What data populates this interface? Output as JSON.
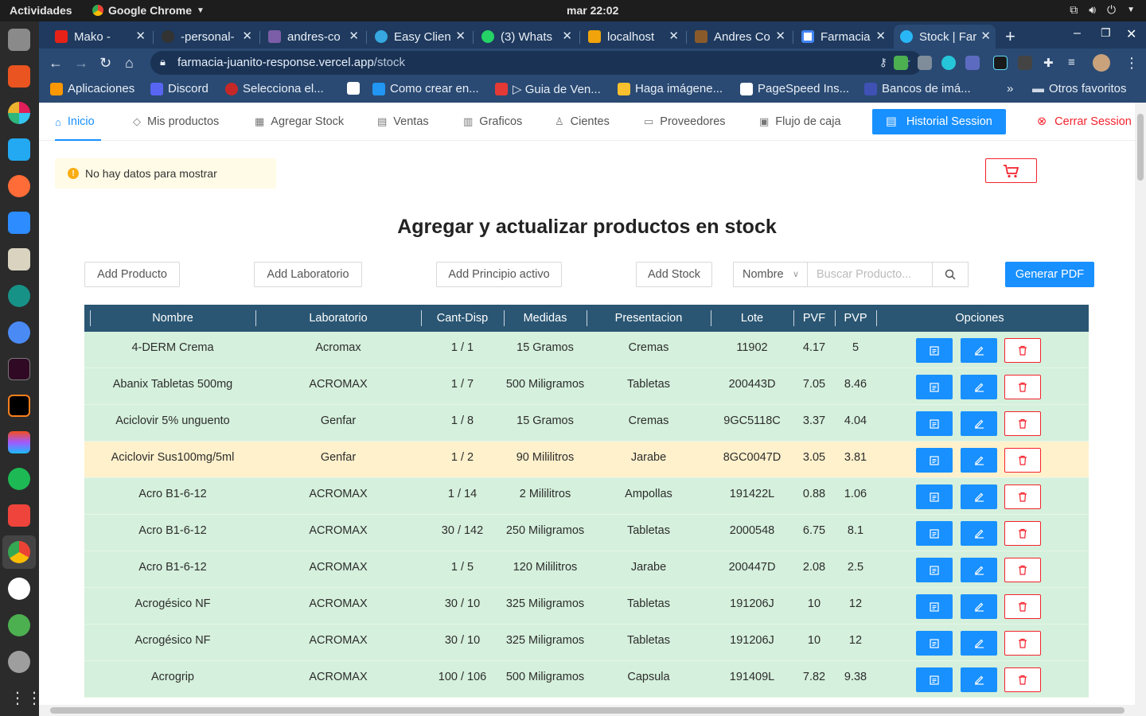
{
  "os": {
    "activities": "Actividades",
    "app_name": "Google Chrome",
    "clock": "mar 22:02"
  },
  "browser": {
    "tabs": [
      {
        "title": "Mako -",
        "color": "#e62117"
      },
      {
        "title": "-personal-",
        "color": "#333333"
      },
      {
        "title": "andres-co",
        "color": "#7b5ea7"
      },
      {
        "title": "Easy Clien",
        "color": "#36a7e0"
      },
      {
        "title": "(3) Whats",
        "color": "#25d366"
      },
      {
        "title": "localhost",
        "color": "#f0a30a"
      },
      {
        "title": "Andres Co",
        "color": "#8b5a2b"
      },
      {
        "title": "Farmacia",
        "color": "#4285f4"
      },
      {
        "title": "Stock | Far",
        "color": "#29b6f6"
      }
    ],
    "url_host": "farmacia-juanito-response.vercel.app",
    "url_path": "/stock",
    "bookmarks": [
      {
        "label": "Aplicaciones",
        "color": "#ff9800"
      },
      {
        "label": "Discord",
        "color": "#5865f2"
      },
      {
        "label": "Selecciona el...",
        "color": "#c62828"
      },
      {
        "label": "",
        "color": "#ffffff"
      },
      {
        "label": "Como crear en...",
        "color": "#2196f3"
      },
      {
        "label": "▷ Guia de Ven...",
        "color": "#e53935"
      },
      {
        "label": "Haga imágene...",
        "color": "#fbc02d"
      },
      {
        "label": "PageSpeed Ins...",
        "color": "#ffffff"
      },
      {
        "label": "Bancos de imá...",
        "color": "#3f51b5"
      }
    ],
    "other_bookmarks": "Otros favoritos"
  },
  "nav": {
    "items": [
      {
        "label": "Inicio",
        "icon": "home-icon"
      },
      {
        "label": "Mis productos",
        "icon": "tag-icon"
      },
      {
        "label": "Agregar Stock",
        "icon": "table-icon"
      },
      {
        "label": "Ventas",
        "icon": "calculator-icon"
      },
      {
        "label": "Graficos",
        "icon": "bar-chart-icon"
      },
      {
        "label": "Cientes",
        "icon": "users-icon"
      },
      {
        "label": "Proveedores",
        "icon": "file-icon"
      },
      {
        "label": "Flujo de caja",
        "icon": "bank-icon"
      }
    ],
    "history_button": "Historial Session",
    "logout": "Cerrar Session"
  },
  "alert": "No hay datos para mostrar",
  "title": "Agregar y actualizar productos en stock",
  "actions": {
    "add_product": "Add Producto",
    "add_lab": "Add Laboratorio",
    "add_principle": "Add Principio activo",
    "add_stock": "Add Stock",
    "filter_selected": "Nombre",
    "search_placeholder": "Buscar Producto...",
    "pdf": "Generar PDF"
  },
  "table": {
    "headers": [
      "Nombre",
      "Laboratorio",
      "Cant-Disp",
      "Medidas",
      "Presentacion",
      "Lote",
      "PVF",
      "PVP",
      "Opciones"
    ],
    "rows": [
      {
        "nombre": "4-DERM Crema",
        "lab": "Acromax",
        "cant": "1 / 1",
        "medidas": "15 Gramos",
        "pres": "Cremas",
        "lote": "11902",
        "pvf": "4.17",
        "pvp": "5",
        "status": "ok"
      },
      {
        "nombre": "Abanix Tabletas 500mg",
        "lab": "ACROMAX",
        "cant": "1 / 7",
        "medidas": "500 Miligramos",
        "pres": "Tabletas",
        "lote": "200443D",
        "pvf": "7.05",
        "pvp": "8.46",
        "status": "ok"
      },
      {
        "nombre": "Aciclovir 5% unguento",
        "lab": "Genfar",
        "cant": "1 / 8",
        "medidas": "15 Gramos",
        "pres": "Cremas",
        "lote": "9GC5118C",
        "pvf": "3.37",
        "pvp": "4.04",
        "status": "ok"
      },
      {
        "nombre": "Aciclovir Sus100mg/5ml",
        "lab": "Genfar",
        "cant": "1 / 2",
        "medidas": "90 Mililitros",
        "pres": "Jarabe",
        "lote": "8GC0047D",
        "pvf": "3.05",
        "pvp": "3.81",
        "status": "warn"
      },
      {
        "nombre": "Acro B1-6-12",
        "lab": "ACROMAX",
        "cant": "1 / 14",
        "medidas": "2 Mililitros",
        "pres": "Ampollas",
        "lote": "191422L",
        "pvf": "0.88",
        "pvp": "1.06",
        "status": "ok"
      },
      {
        "nombre": "Acro B1-6-12",
        "lab": "ACROMAX",
        "cant": "30 / 142",
        "medidas": "250 Miligramos",
        "pres": "Tabletas",
        "lote": "2000548",
        "pvf": "6.75",
        "pvp": "8.1",
        "status": "ok"
      },
      {
        "nombre": "Acro B1-6-12",
        "lab": "ACROMAX",
        "cant": "1 / 5",
        "medidas": "120 Mililitros",
        "pres": "Jarabe",
        "lote": "200447D",
        "pvf": "2.08",
        "pvp": "2.5",
        "status": "ok"
      },
      {
        "nombre": "Acrogésico NF",
        "lab": "ACROMAX",
        "cant": "30 / 10",
        "medidas": "325 Miligramos",
        "pres": "Tabletas",
        "lote": "191206J",
        "pvf": "10",
        "pvp": "12",
        "status": "ok"
      },
      {
        "nombre": "Acrogésico NF",
        "lab": "ACROMAX",
        "cant": "30 / 10",
        "medidas": "325 Miligramos",
        "pres": "Tabletas",
        "lote": "191206J",
        "pvf": "10",
        "pvp": "12",
        "status": "ok"
      },
      {
        "nombre": "Acrogrip",
        "lab": "ACROMAX",
        "cant": "100 / 106",
        "medidas": "500 Miligramos",
        "pres": "Capsula",
        "lote": "191409L",
        "pvf": "7.82",
        "pvp": "9.38",
        "status": "ok"
      }
    ]
  }
}
